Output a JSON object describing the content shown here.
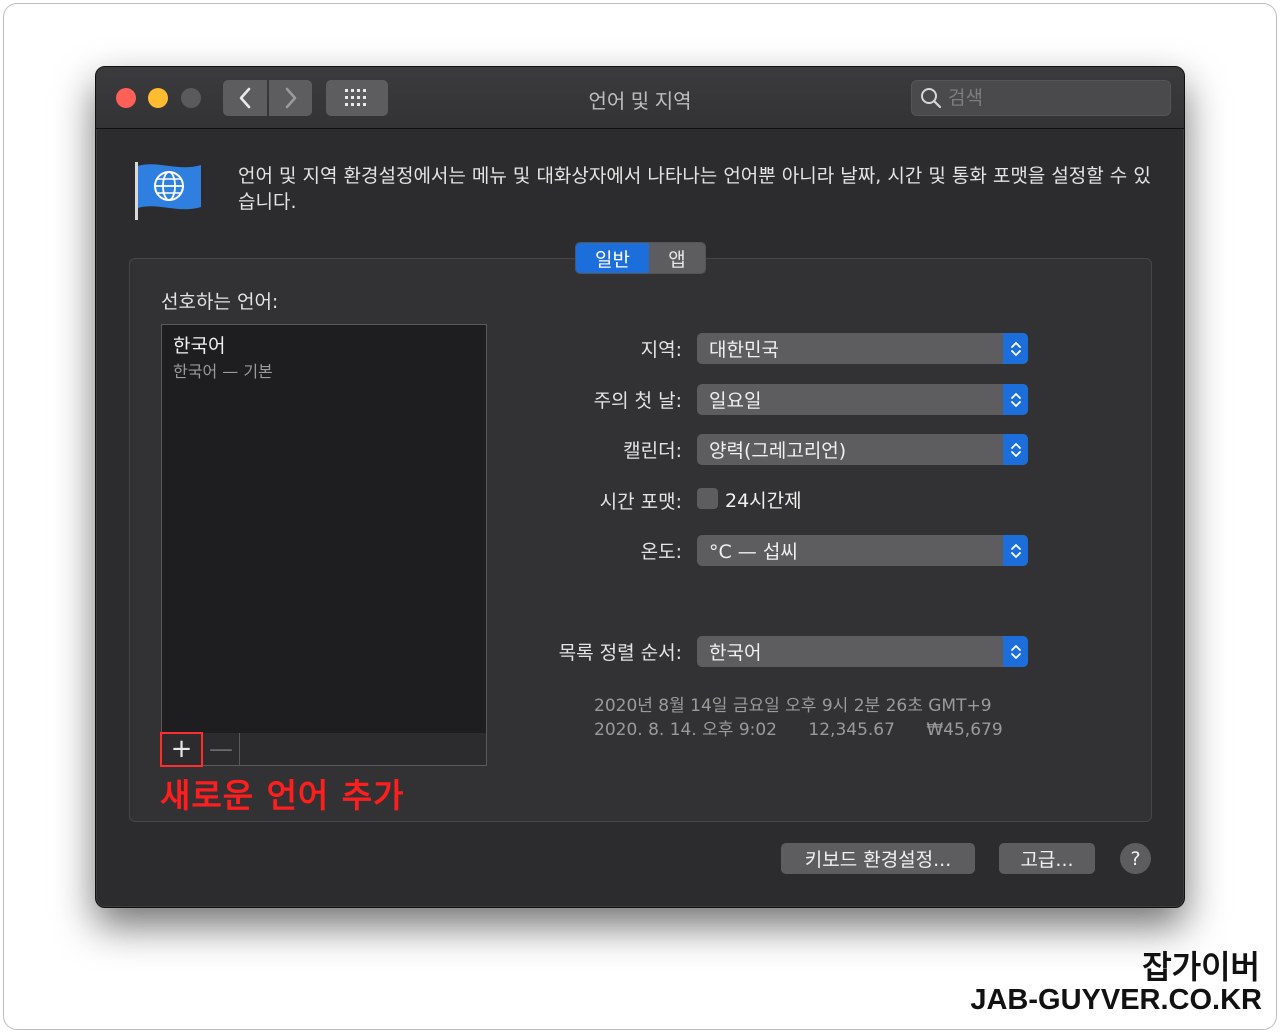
{
  "window": {
    "title": "언어 및 지역",
    "search_placeholder": "검색",
    "description": "언어 및 지역 환경설정에서는 메뉴 및 대화상자에서 나타나는 언어뿐 아니라 날짜, 시간 및 통화 포맷을 설정할 수 있습니다."
  },
  "tabs": [
    {
      "label": "일반",
      "selected": true
    },
    {
      "label": "앱",
      "selected": false
    }
  ],
  "languages": {
    "label": "선호하는 언어:",
    "items": [
      {
        "name": "한국어",
        "subtitle": "한국어 — 기본"
      }
    ],
    "add_label": "+",
    "remove_label": "—"
  },
  "settings": {
    "region": {
      "label": "지역:",
      "value": "대한민국"
    },
    "first_day": {
      "label": "주의 첫 날:",
      "value": "일요일"
    },
    "calendar": {
      "label": "캘린더:",
      "value": "양력(그레고리언)"
    },
    "time_format": {
      "label": "시간 포맷:",
      "checkbox_label": "24시간제",
      "checked": false
    },
    "temperature": {
      "label": "온도:",
      "value": "°C — 섭씨"
    },
    "sort_order": {
      "label": "목록 정렬 순서:",
      "value": "한국어"
    }
  },
  "samples": {
    "line1": "2020년 8월 14일 금요일 오후 9시 2분 26초 GMT+9",
    "date_short": "2020. 8. 14. 오후 9:02",
    "number": "12,345.67",
    "currency": "₩45,679"
  },
  "buttons": {
    "keyboard": "키보드 환경설정...",
    "advanced": "고급...",
    "help": "?"
  },
  "annotation": "새로운 언어 추가",
  "watermark": {
    "line1": "잡가이버",
    "line2": "JAB-GUYVER.CO.KR"
  },
  "colors": {
    "accent": "#1c6edb",
    "annotation": "#ff1e1e"
  }
}
